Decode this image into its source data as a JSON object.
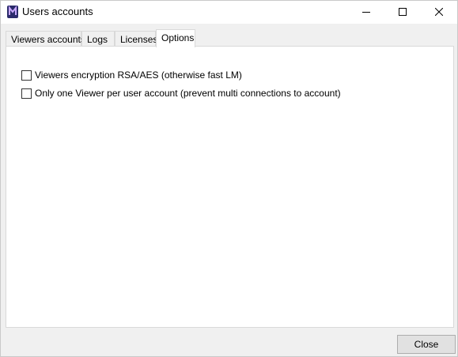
{
  "window": {
    "title": "Users accounts",
    "icon": "app-logo-icon",
    "controls": {
      "minimize_icon": "minimize-icon",
      "maximize_icon": "maximize-icon",
      "close_icon": "close-icon"
    }
  },
  "tabs": [
    {
      "label": "Viewers accounts",
      "active": false
    },
    {
      "label": "Logs",
      "active": false
    },
    {
      "label": "Licenses",
      "active": false
    },
    {
      "label": "Options",
      "active": true
    }
  ],
  "options": [
    {
      "label": "Viewers encryption RSA/AES (otherwise fast LM)",
      "checked": false
    },
    {
      "label": "Only one Viewer per user account (prevent multi connections to account)",
      "checked": false
    }
  ],
  "footer": {
    "close_label": "Close"
  },
  "colors": {
    "accent": "#7a3fd0",
    "panel_bg": "#ffffff",
    "window_bg": "#f0f0f0"
  }
}
